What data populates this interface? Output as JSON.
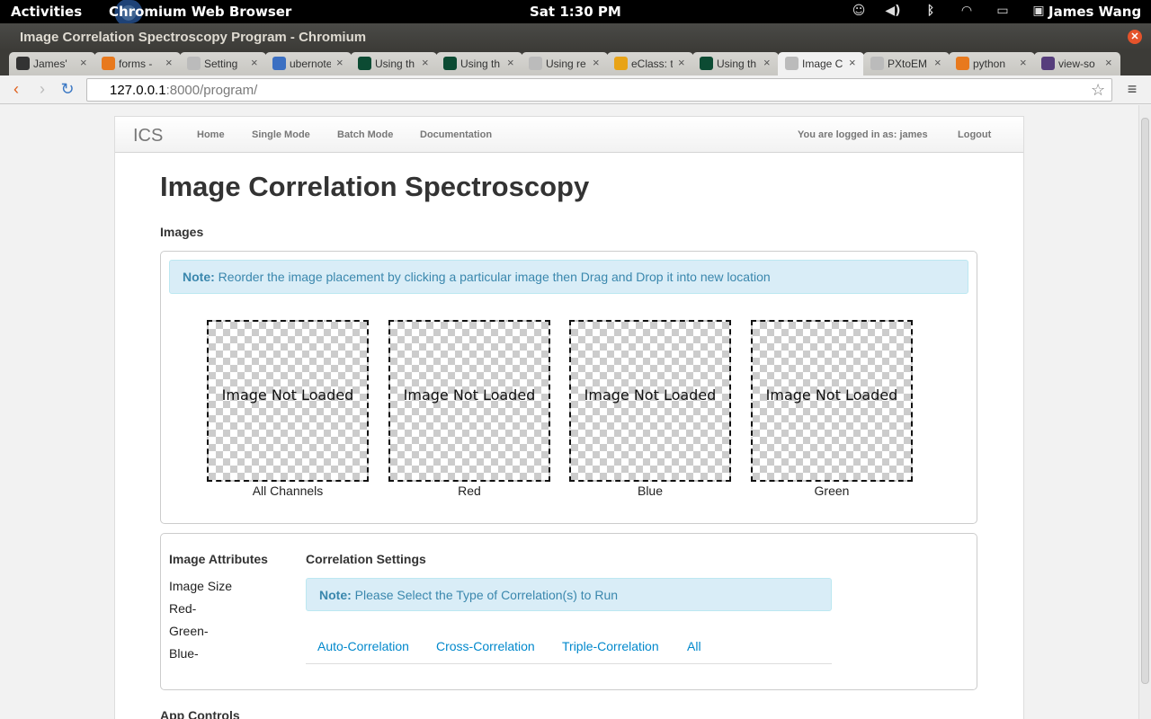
{
  "system": {
    "activities": "Activities",
    "app_name": "Chromium Web Browser",
    "clock": "Sat  1:30 PM",
    "user": "James Wang",
    "icons": [
      "accessibility-icon",
      "volume-icon",
      "bluetooth-icon",
      "wifi-icon",
      "battery-icon"
    ]
  },
  "window": {
    "title": "Image Correlation Spectroscopy Program - Chromium"
  },
  "tabs": [
    {
      "label": "James'",
      "icon": "github-icon",
      "color": "#333333"
    },
    {
      "label": "forms -",
      "icon": "stackoverflow-icon",
      "color": "#e8791d"
    },
    {
      "label": "Setting",
      "icon": "page-icon",
      "color": "#bbbbbb"
    },
    {
      "label": "ubernote",
      "icon": "shield-icon",
      "color": "#3b6fc2"
    },
    {
      "label": "Using th",
      "icon": "django-icon",
      "color": "#0c4b33"
    },
    {
      "label": "Using th",
      "icon": "django-icon",
      "color": "#0c4b33"
    },
    {
      "label": "Using re",
      "icon": "page-icon",
      "color": "#bbbbbb"
    },
    {
      "label": "eClass: t",
      "icon": "eclass-icon",
      "color": "#e8a317"
    },
    {
      "label": "Using th",
      "icon": "django-icon",
      "color": "#0c4b33"
    },
    {
      "label": "Image C",
      "icon": "page-icon",
      "color": "#bbbbbb",
      "active": true
    },
    {
      "label": "PXtoEM",
      "icon": "page-icon",
      "color": "#bbbbbb"
    },
    {
      "label": "python",
      "icon": "stackoverflow-icon",
      "color": "#e8791d"
    },
    {
      "label": "view-so",
      "icon": "bootstrap-icon",
      "color": "#563d7c"
    }
  ],
  "address": {
    "host": "127.0.0.1",
    "path": ":8000/program/"
  },
  "nav": {
    "brand": "ICS",
    "links": [
      "Home",
      "Single Mode",
      "Batch Mode",
      "Documentation"
    ],
    "logged_in": "You are logged in as: james",
    "logout": "Logout"
  },
  "main": {
    "heading": "Image Correlation Spectroscopy",
    "images_label": "Images",
    "note_strong": "Note:",
    "note_text": " Reorder the image placement by clicking a particular image then Drag and Drop it into new location",
    "placeholder": "Image Not Loaded",
    "captions": [
      "All Channels",
      "Red",
      "Blue",
      "Green"
    ]
  },
  "attributes": {
    "title": "Image Attributes",
    "rows": [
      "Image Size",
      "Red-",
      "Green-",
      "Blue-"
    ]
  },
  "correlation": {
    "title": "Correlation Settings",
    "note_strong": "Note:",
    "note_text": " Please Select the Type of Correlation(s) to Run",
    "tabs": [
      "Auto-Correlation",
      "Cross-Correlation",
      "Triple-Correlation",
      "All"
    ]
  },
  "app_controls": "App Controls",
  "colors": {
    "accent": "#0088cc",
    "alert_bg": "#d9edf7",
    "alert_text": "#3a87ad"
  }
}
